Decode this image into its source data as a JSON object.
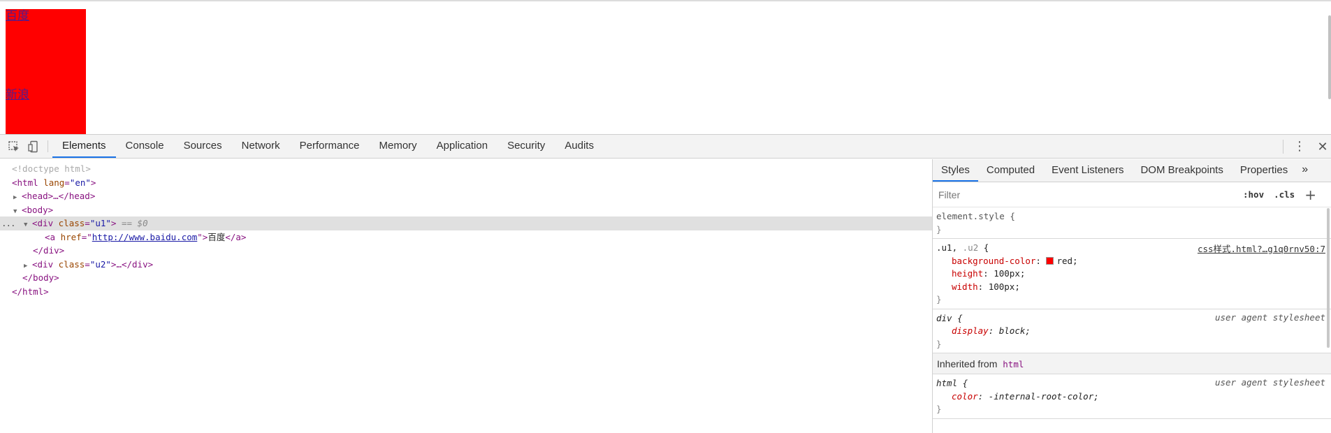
{
  "page": {
    "u1_link": "百度",
    "u2_link": "新浪"
  },
  "devtools": {
    "tabs": [
      {
        "label": "Elements",
        "active": true
      },
      {
        "label": "Console"
      },
      {
        "label": "Sources"
      },
      {
        "label": "Network"
      },
      {
        "label": "Performance"
      },
      {
        "label": "Memory"
      },
      {
        "label": "Application"
      },
      {
        "label": "Security"
      },
      {
        "label": "Audits"
      }
    ],
    "toolbar_icons": [
      "inspect-element-icon",
      "device-toolbar-icon",
      "kebab-menu-icon",
      "close-icon"
    ],
    "dom": {
      "doctype": "<!doctype html>",
      "html_open": "<html",
      "html_attr_name": "lang",
      "html_attr_value": "\"en\"",
      "html_close_bracket": ">",
      "head": "<head>…</head>",
      "body_open": "<body>",
      "div_open": "<div",
      "class_attr": "class",
      "u1_value": "\"u1\"",
      "selected_marker": "== $0",
      "a_open": "<a",
      "href_attr": "href",
      "href_value": "http://www.baidu.com",
      "a_text": "百度",
      "a_close": "</a>",
      "div_close": "</div>",
      "u2_value": "\"u2\"",
      "collapsed_close": "…</div>",
      "body_close": "</body>",
      "html_close": "</html>",
      "dots": "..."
    },
    "side_tabs": [
      {
        "label": "Styles",
        "active": true
      },
      {
        "label": "Computed"
      },
      {
        "label": "Event Listeners"
      },
      {
        "label": "DOM Breakpoints"
      },
      {
        "label": "Properties"
      },
      {
        "label": "»"
      }
    ],
    "filter_placeholder": "Filter",
    "hov_label": ":hov",
    "cls_label": ".cls",
    "add_rule_label": "+",
    "rules": {
      "element_style_selector": "element.style {",
      "close_brace": "}",
      "u_selector_a": ".u1",
      "u_selector_sep": ",",
      "u_selector_b": ".u2",
      "u_selector_brace": "{",
      "u_source": "css样式.html?…g1q0rnv50:7",
      "bg_prop": "background-color",
      "bg_value": "red;",
      "height_prop": "height",
      "height_value": "100px;",
      "width_prop": "width",
      "width_value": "100px;",
      "div_selector": "div {",
      "ua_source": "user agent stylesheet",
      "display_prop": "display",
      "display_value": "block;",
      "inherited_label": "Inherited from",
      "inherited_tag": "html",
      "html_selector": "html {",
      "color_prop": "color",
      "color_value": "-internal-root-color;"
    },
    "swatch_color": "#ff0000",
    "active_tab_color": "#1a73e8"
  }
}
